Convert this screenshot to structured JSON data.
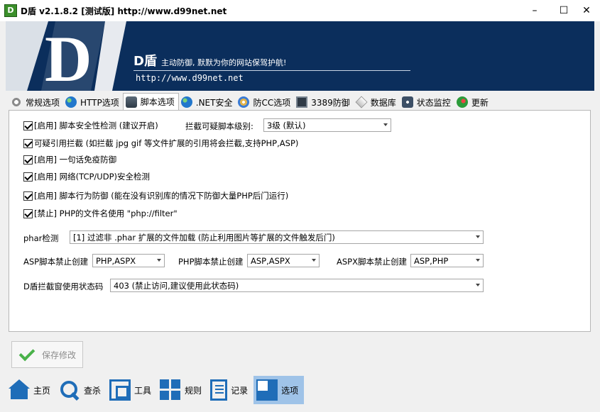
{
  "window": {
    "title": "D盾 v2.1.8.2 [测试版] http://www.d99net.net",
    "app_icon_text": "D",
    "minimize": "–",
    "maximize": "☐",
    "close": "✕"
  },
  "banner": {
    "logo_letter": "D",
    "brand": "D盾",
    "slogan": "主动防御, 默默为你的网站保驾护航!",
    "url": "http://www.d99net.net",
    "background_color": "#0b2e5c"
  },
  "tabs": [
    {
      "label": "常规选项",
      "icon": "gear-icon"
    },
    {
      "label": "HTTP选项",
      "icon": "globe-icon"
    },
    {
      "label": "脚本选项",
      "icon": "script-icon",
      "active": true
    },
    {
      "label": ".NET安全",
      "icon": "globe-icon"
    },
    {
      "label": "防CC选项",
      "icon": "disc-icon"
    },
    {
      "label": "3389防御",
      "icon": "monitor-icon"
    },
    {
      "label": "数据库",
      "icon": "database-icon"
    },
    {
      "label": "状态监控",
      "icon": "status-icon"
    },
    {
      "label": "更新",
      "icon": "update-icon"
    }
  ],
  "options": {
    "script_check": "[启用] 脚本安全性检测 (建议开启)",
    "intercept_level_label": "拦截可疑脚本级别:",
    "intercept_level_value": "3级 (默认)",
    "suspicious_ref": "可疑引用拦截 (如拦截 jpg gif 等文件扩展的引用将会拦截,支持PHP,ASP)",
    "one_liner": "[启用] 一句话免疫防御",
    "network_check": "[启用] 网络(TCP/UDP)安全检测",
    "behavior_defense": "[启用] 脚本行为防御 (能在没有识别库的情况下防御大量PHP后门运行)",
    "php_filter": "[禁止] PHP的文件名使用 \"php://filter\"",
    "phar_label": "phar检测",
    "phar_value": "[1] 过滤非 .phar 扩展的文件加载 (防止利用图片等扩展的文件触发后门)",
    "asp_label": "ASP脚本禁止创建",
    "asp_value": "PHP,ASPX",
    "php_label": "PHP脚本禁止创建",
    "php_value": "ASP,ASPX",
    "aspx_label": "ASPX脚本禁止创建",
    "aspx_value": "ASP,PHP",
    "status_label": "D盾拦截窗使用状态码",
    "status_value": "403 (禁止访问,建议使用此状态码)"
  },
  "save_button": "保存修改",
  "bottom_nav": [
    {
      "label": "主页",
      "icon": "home-icon"
    },
    {
      "label": "查杀",
      "icon": "search-icon"
    },
    {
      "label": "工具",
      "icon": "tools-icon"
    },
    {
      "label": "规则",
      "icon": "rules-icon"
    },
    {
      "label": "记录",
      "icon": "log-icon"
    },
    {
      "label": "选项",
      "icon": "options-icon",
      "active": true
    }
  ],
  "colors": {
    "accent": "#1f6db8",
    "active_nav_bg": "#9fc3e8",
    "check_green": "#49b24a"
  }
}
